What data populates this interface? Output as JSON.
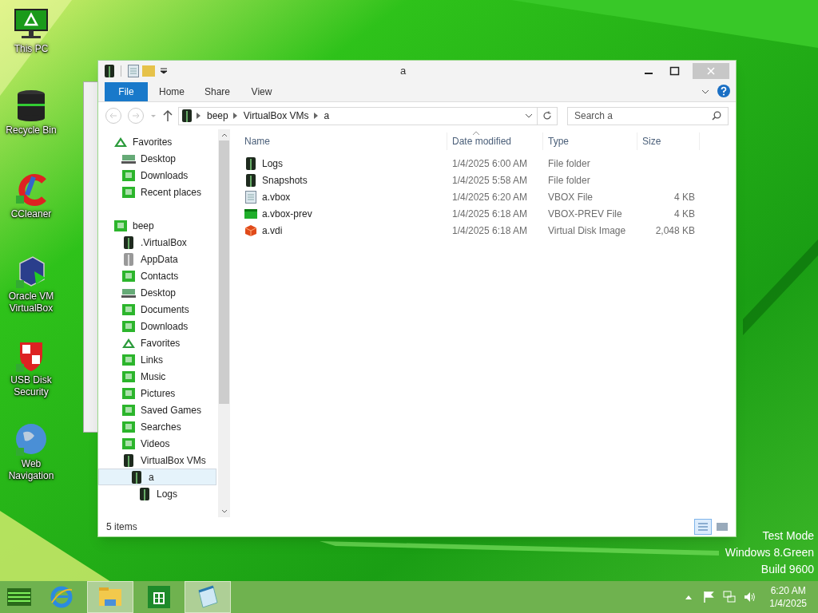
{
  "desktop": {
    "icons": [
      {
        "label": "This PC",
        "kind": "monitor"
      },
      {
        "label": "Recycle Bin",
        "kind": "bin"
      },
      {
        "label": "CCleaner",
        "kind": "cleaner"
      },
      {
        "label": "Oracle VM VirtualBox",
        "kind": "cube"
      },
      {
        "label": "USB Disk Security",
        "kind": "shield"
      },
      {
        "label": "Web Navigation",
        "kind": "globe"
      }
    ]
  },
  "window": {
    "title": "a",
    "ribbon_tabs": [
      {
        "label": "File",
        "selected": true
      },
      {
        "label": "Home",
        "selected": false
      },
      {
        "label": "Share",
        "selected": false
      },
      {
        "label": "View",
        "selected": false
      }
    ],
    "address": [
      "beep",
      "VirtualBox VMs",
      "a"
    ],
    "search": {
      "placeholder": "Search a"
    },
    "nav": [
      {
        "label": "Favorites",
        "kind": "star",
        "selected": false,
        "children": [
          {
            "label": "Desktop",
            "kind": "desktop",
            "selected": false
          },
          {
            "label": "Downloads",
            "kind": "green",
            "selected": false
          },
          {
            "label": "Recent places",
            "kind": "green",
            "selected": false
          }
        ]
      },
      {
        "label": "beep",
        "kind": "green",
        "selected": false,
        "children": [
          {
            "label": ".VirtualBox",
            "kind": "dark",
            "selected": false
          },
          {
            "label": "AppData",
            "kind": "grey",
            "selected": false
          },
          {
            "label": "Contacts",
            "kind": "green",
            "selected": false
          },
          {
            "label": "Desktop",
            "kind": "desktop",
            "selected": false
          },
          {
            "label": "Documents",
            "kind": "green",
            "selected": false
          },
          {
            "label": "Downloads",
            "kind": "green",
            "selected": false
          },
          {
            "label": "Favorites",
            "kind": "star",
            "selected": false
          },
          {
            "label": "Links",
            "kind": "green",
            "selected": false
          },
          {
            "label": "Music",
            "kind": "green",
            "selected": false
          },
          {
            "label": "Pictures",
            "kind": "green",
            "selected": false
          },
          {
            "label": "Saved Games",
            "kind": "green",
            "selected": false
          },
          {
            "label": "Searches",
            "kind": "green",
            "selected": false
          },
          {
            "label": "Videos",
            "kind": "green",
            "selected": false
          },
          {
            "label": "VirtualBox VMs",
            "kind": "dark",
            "selected": false,
            "children": [
              {
                "label": "a",
                "kind": "dark",
                "selected": true,
                "children": [
                  {
                    "label": "Logs",
                    "kind": "dark",
                    "selected": false
                  }
                ]
              }
            ]
          }
        ]
      }
    ],
    "columns": [
      "Name",
      "Date modified",
      "Type",
      "Size"
    ],
    "rows": [
      {
        "name": "Logs",
        "date": "1/4/2025 6:00 AM",
        "type": "File folder",
        "size": "",
        "kind": "dark"
      },
      {
        "name": "Snapshots",
        "date": "1/4/2025 5:58 AM",
        "type": "File folder",
        "size": "",
        "kind": "dark"
      },
      {
        "name": "a.vbox",
        "date": "1/4/2025 6:20 AM",
        "type": "VBOX File",
        "size": "4 KB",
        "kind": "doc"
      },
      {
        "name": "a.vbox-prev",
        "date": "1/4/2025 6:18 AM",
        "type": "VBOX-PREV File",
        "size": "4 KB",
        "kind": "greenbar"
      },
      {
        "name": "a.vdi",
        "date": "1/4/2025 6:18 AM",
        "type": "Virtual Disk Image",
        "size": "2,048 KB",
        "kind": "box"
      }
    ],
    "status": "5 items"
  },
  "watermark": [
    "Test Mode",
    "Windows 8.Green",
    "Build 9600"
  ],
  "taskbar": {
    "apps": [
      {
        "kind": "browser",
        "open": false
      },
      {
        "kind": "explorer",
        "open": true
      },
      {
        "kind": "store",
        "open": false
      },
      {
        "kind": "notepad",
        "open": true
      }
    ],
    "time": "6:20 AM",
    "date": "1/4/2025"
  }
}
